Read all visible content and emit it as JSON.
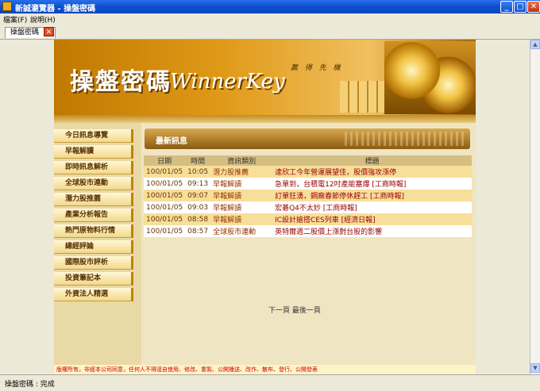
{
  "window": {
    "title": "新誠瀏覽器 - 操盤密碼"
  },
  "menu": [
    "檔案(F)",
    "說明(H)"
  ],
  "tab": {
    "label": "操盤密碼"
  },
  "banner": {
    "logo_cn": "操盤密碼",
    "logo_en": "WinnerKey",
    "slogan": "贏 得 先 機"
  },
  "sidebar": {
    "items": [
      "今日訊息導覽",
      "早報解讀",
      "即時訊息解析",
      "全球股市連動",
      "潛力股推薦",
      "產業分析報告",
      "熱門原物料行情",
      "總經評論",
      "國際股市評析",
      "投資筆記本",
      "外資法人精選"
    ]
  },
  "panel": {
    "title": "最新訊息",
    "columns": [
      "日期",
      "時間",
      "資訊類別",
      "標題"
    ],
    "rows": [
      {
        "date": "100/01/05",
        "time": "10:05",
        "category": "潛力股推薦",
        "title": "達欣工今年營運展望佳，股價強攻漲停"
      },
      {
        "date": "100/01/05",
        "time": "09:13",
        "category": "早報解讀",
        "title": "急單到，台積電12吋產能塞爆 [工商時報]"
      },
      {
        "date": "100/01/05",
        "time": "09:07",
        "category": "早報解讀",
        "title": "訂單狂湧，鋼廠春節停休趕工 [工商時報]"
      },
      {
        "date": "100/01/05",
        "time": "09:03",
        "category": "早報解讀",
        "title": "宏碁Q4不太妙 [工商時報]"
      },
      {
        "date": "100/01/05",
        "time": "08:58",
        "category": "早報解讀",
        "title": "IC設計搶搭CES列車 [經濟日報]"
      },
      {
        "date": "100/01/05",
        "time": "08:57",
        "category": "全球股市連動",
        "title": "英特爾週二股價上漲對台股的影響"
      }
    ],
    "pager": {
      "next": "下一頁",
      "last": "最後一頁"
    }
  },
  "footer": {
    "text": "版權所有，非經本公司同意，任何人不得逕自使用、修改、重製、公開播送、改作、散布、發行、公開發表"
  },
  "status": {
    "text": "操盤密碼 : 完成"
  }
}
